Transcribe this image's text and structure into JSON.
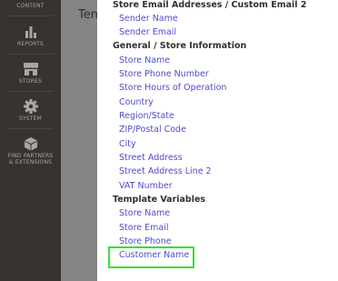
{
  "sidebar": {
    "items": [
      {
        "label": "CONTENT",
        "icon": "content-icon"
      },
      {
        "label": "REPORTS",
        "icon": "bar-chart-icon"
      },
      {
        "label": "STORES",
        "icon": "store-icon"
      },
      {
        "label": "SYSTEM",
        "icon": "gear-icon"
      },
      {
        "label_line1": "FIND PARTNERS",
        "label_line2": "& EXTENSIONS",
        "icon": "cube-icon"
      }
    ]
  },
  "background": {
    "page_title": "Tem"
  },
  "panel": {
    "groups": [
      {
        "title": "Store Email Addresses / Custom Email 2",
        "items": [
          "Sender Name",
          "Sender Email"
        ]
      },
      {
        "title": "General / Store Information",
        "items": [
          "Store Name",
          "Store Phone Number",
          "Store Hours of Operation",
          "Country",
          "Region/State",
          "ZIP/Postal Code",
          "City",
          "Street Address",
          "Street Address Line 2",
          "VAT Number"
        ]
      },
      {
        "title": "Template Variables",
        "items": [
          "Store Name",
          "Store Email",
          "Store Phone",
          "Customer Name"
        ]
      }
    ]
  },
  "colors": {
    "sidebar": "#373330",
    "link": "#4d4dcc",
    "highlight": "#2ee52e",
    "overlay": "#858585"
  }
}
